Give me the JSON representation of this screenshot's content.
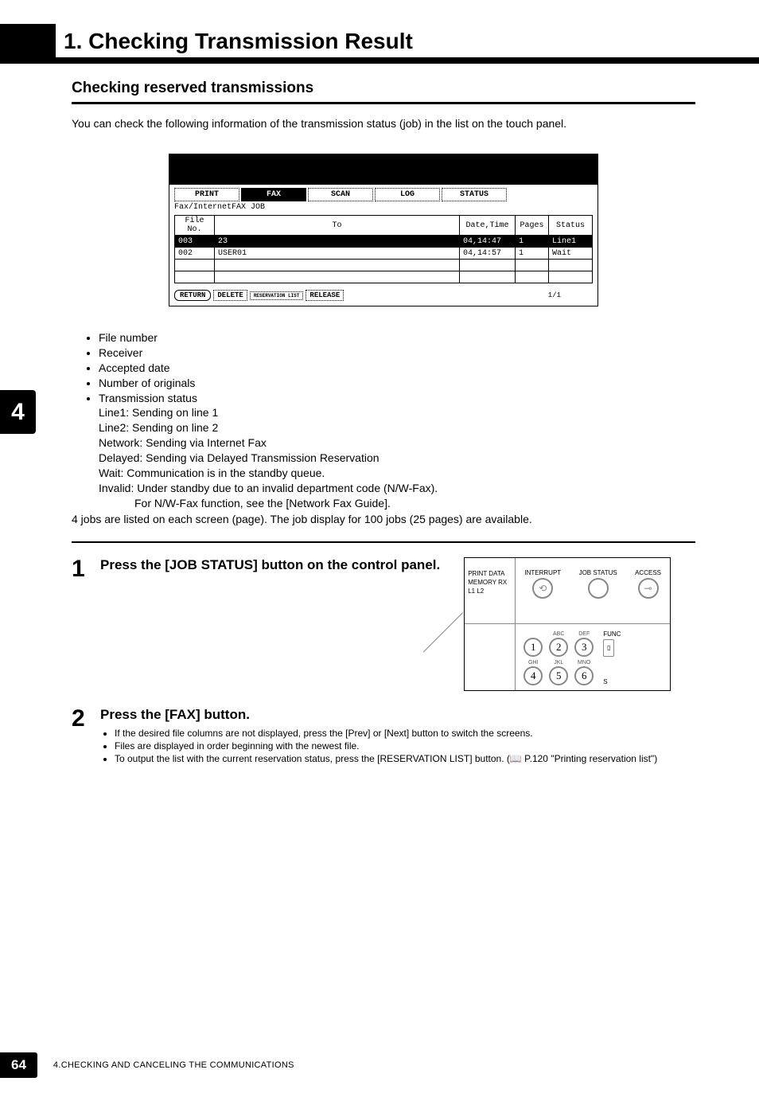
{
  "header": {
    "title": "1. Checking Transmission Result"
  },
  "section": {
    "subheading": "Checking reserved transmissions",
    "intro": "You can check the following information of the transmission status (job) in the list on the touch panel."
  },
  "screenshot": {
    "tabs": {
      "print": "PRINT",
      "fax": "FAX",
      "scan": "SCAN",
      "log": "LOG",
      "status": "STATUS"
    },
    "job_label": "Fax/InternetFAX JOB",
    "columns": {
      "file_no": "File No.",
      "to": "To",
      "date_time": "Date,Time",
      "pages": "Pages",
      "status": "Status"
    },
    "rows": [
      {
        "file_no": "003",
        "to": "23",
        "date_time": "04,14:47",
        "pages": "1",
        "status": "Line1",
        "selected": true
      },
      {
        "file_no": "002",
        "to": "USER01",
        "date_time": "04,14:57",
        "pages": "1",
        "status": "Wait",
        "selected": false
      }
    ],
    "buttons": {
      "return": "RETURN",
      "delete": "DELETE",
      "reservation_list": "RESERVATION LIST",
      "release": "RELEASE"
    },
    "page_indicator": "1/1"
  },
  "side_tab": "4",
  "info_bullets": [
    "File number",
    "Receiver",
    "Accepted date",
    "Number of originals",
    "Transmission status"
  ],
  "status_lines": {
    "line1": "Line1: Sending on line 1",
    "line2": "Line2: Sending on line 2",
    "network": "Network: Sending via Internet Fax",
    "delayed": "Delayed: Sending via Delayed Transmission Reservation",
    "wait": "Wait: Communication is in the standby queue.",
    "invalid": "Invalid: Under standby due to an invalid department code (N/W-Fax).",
    "invalid_note": "For N/W-Fax function, see the [Network Fax Guide]."
  },
  "closing": "4 jobs are listed on each screen (page). The job display for 100 jobs (25 pages) are available.",
  "steps": {
    "s1": {
      "num": "1",
      "title": "Press the [JOB STATUS] button on the control panel."
    },
    "s2": {
      "num": "2",
      "title": "Press the [FAX] button.",
      "notes": [
        "If the desired file columns are not displayed, press the [Prev] or [Next] button to switch the screens.",
        "Files are displayed in order beginning with the newest file.",
        "To output the list with the current reservation status, press the [RESERVATION LIST] button. (📖 P.120 \"Printing reservation list\")"
      ]
    }
  },
  "panel": {
    "left_top": {
      "l1": "PRINT DATA",
      "l2": "MEMORY RX",
      "l3": "L1   L2"
    },
    "buttons": {
      "interrupt": "INTERRUPT",
      "job_status": "JOB STATUS",
      "access": "ACCESS"
    },
    "keys": {
      "r1": [
        {
          "n": "1",
          "s": ""
        },
        {
          "n": "2",
          "s": "ABC"
        },
        {
          "n": "3",
          "s": "DEF"
        }
      ],
      "r2": [
        {
          "n": "4",
          "s": "GHI"
        },
        {
          "n": "5",
          "s": "JKL"
        },
        {
          "n": "6",
          "s": "MNO"
        }
      ]
    },
    "func": "FUNC",
    "s": "S"
  },
  "footer": {
    "page": "64",
    "text": "4.CHECKING AND CANCELING THE COMMUNICATIONS"
  }
}
